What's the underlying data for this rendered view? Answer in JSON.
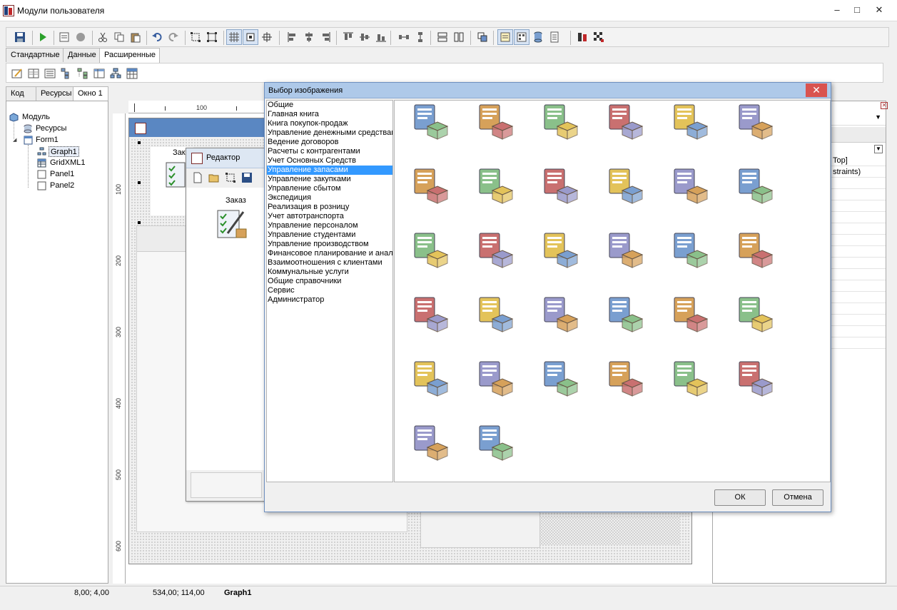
{
  "window": {
    "title": "Модули пользователя",
    "controls": {
      "minimize": "–",
      "maximize": "□",
      "close": "✕"
    }
  },
  "palette_tabs": [
    {
      "label": "Стандартные",
      "active": false
    },
    {
      "label": "Данные",
      "active": false
    },
    {
      "label": "Расширенные",
      "active": true
    }
  ],
  "left_tabs": [
    {
      "label": "Код",
      "active": false
    },
    {
      "label": "Ресурсы",
      "active": false
    },
    {
      "label": "Окно 1",
      "active": true
    }
  ],
  "tree": {
    "root": "Модуль",
    "items": [
      {
        "label": "Ресурсы",
        "icon": "database-icon"
      },
      {
        "label": "Form1",
        "icon": "form-icon"
      },
      {
        "label": "Graph1",
        "icon": "graph-icon",
        "selected": true
      },
      {
        "label": "GridXML1",
        "icon": "grid-icon"
      },
      {
        "label": "Panel1",
        "icon": "panel-icon"
      },
      {
        "label": "Panel2",
        "icon": "panel-icon"
      }
    ]
  },
  "rulers": {
    "top": [
      "100"
    ],
    "left": [
      "100",
      "200",
      "300",
      "400",
      "500",
      "600"
    ]
  },
  "form": {
    "graph_label_partial": "Зак"
  },
  "editor": {
    "title": "Редактор",
    "node_label": "Заказ"
  },
  "dialog": {
    "title": "Выбор изображения",
    "close": "✕",
    "categories": [
      "Общие",
      "Главная книга",
      "Книга покупок-продаж",
      "Управление денежными средствами",
      "Ведение договоров",
      "Расчеты с контрагентами",
      "Учет Основных Средств",
      "Управление запасами",
      "Управление закупками",
      "Управление сбытом",
      "Экспедиция",
      "Реализация в розницу",
      "Учет автотранспорта",
      "Управление персоналом",
      "Управление студентами",
      "Управление производством",
      "Финансовое планирование и анализ",
      "Взаимоотношения с клиентами",
      "Коммунальные услуги",
      "Общие справочники",
      "Сервис",
      "Администратор"
    ],
    "selected_category": "Управление запасами",
    "images": [
      [
        "wrench-box-icon",
        "traffic-light-box-icon",
        "document-box-icon",
        "calculator-box-icon",
        "calculator-percent-box-icon",
        "price-box-icon"
      ],
      [
        "refresh-box-icon",
        "dollar-box-icon",
        "notebook-box-icon",
        "documents-box-icon",
        "warehouse-boxes-icon",
        "warehouse-colored-icon"
      ],
      [
        "refresh-warehouse-icon",
        "boxes-exchange-icon",
        "boxes-transfer-icon",
        "truck-warehouse-icon",
        "document-out-warehouse-icon",
        "document-in-warehouse-icon"
      ],
      [
        "document-arrow-warehouse-icon",
        "exchange-warehouse-icon",
        "checklist-x-warehouse-icon",
        "checklist-warehouse-icon",
        "person-cart-green-icon",
        "person-cart-orange-icon"
      ],
      [
        "person-cart-pencil-icon",
        "cart-refresh-pencil-icon",
        "warehouse-pencil-icon",
        "refresh-document-pencil-icon",
        "calculator-percent-pencil-icon",
        "checklist-x-pencil-icon"
      ],
      [
        "coat-pencil-icon",
        "chart-pencil-icon"
      ]
    ],
    "ok": "ОК",
    "cancel": "Отмена"
  },
  "properties": {
    "lines": [
      "Top]",
      "straints)"
    ]
  },
  "status": {
    "pos1": "8,00; 4,00",
    "pos2": "534,00; 114,00",
    "component": "Graph1"
  },
  "colors": {
    "selection": "#3399ff",
    "caption_blue": "#5a87c2",
    "dialog_caption": "#aec9e9",
    "close_red": "#d9534f"
  }
}
